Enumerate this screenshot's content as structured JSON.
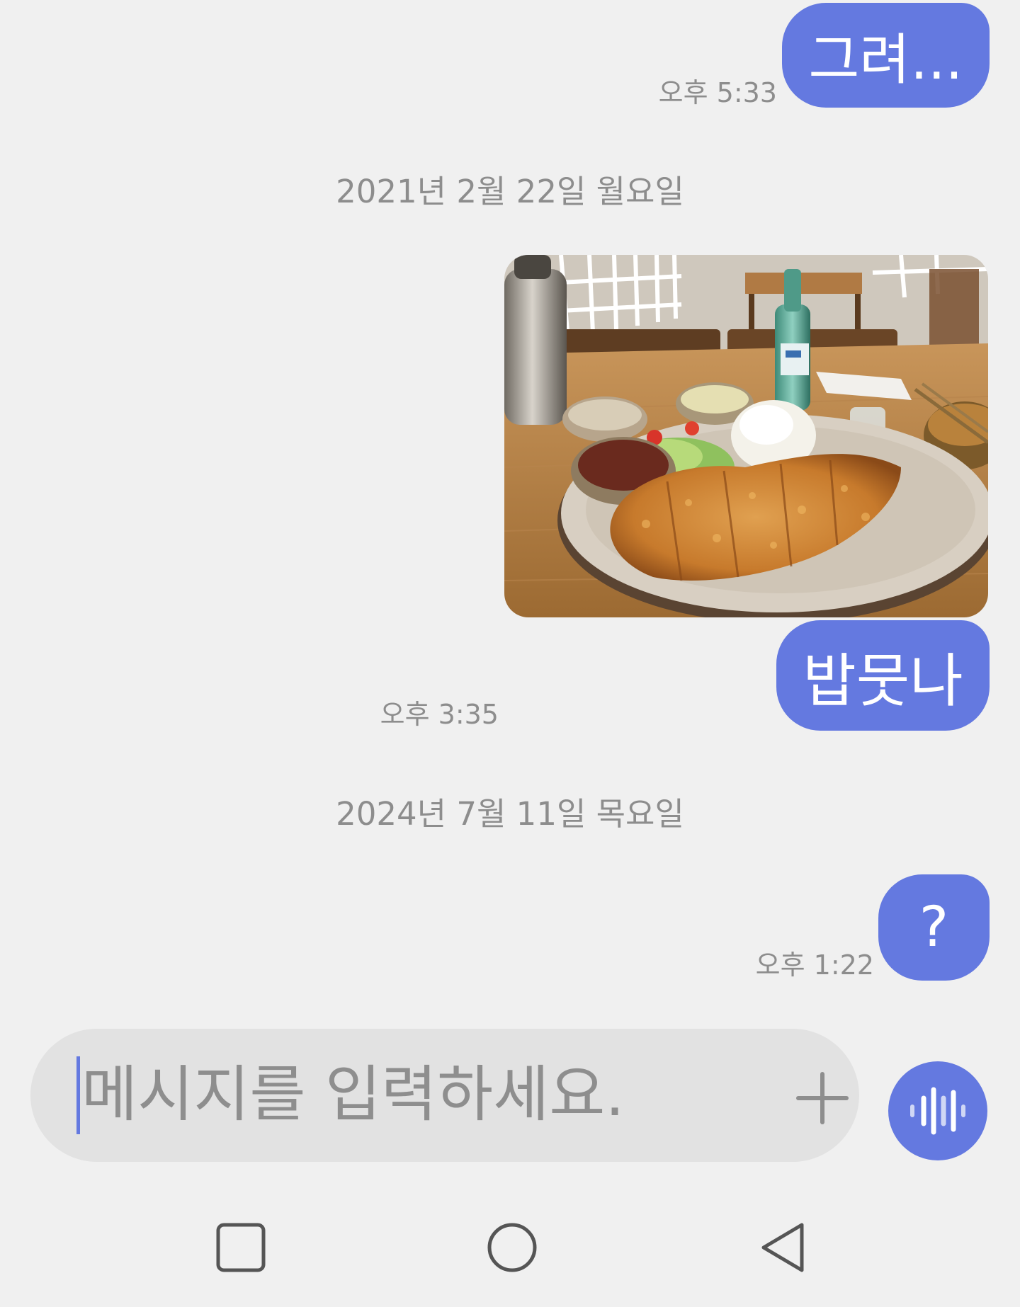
{
  "conversation": {
    "messages": [
      {
        "text": "그려...",
        "time": "오후 5:33"
      },
      {
        "text": "밥뭇나",
        "time": "오후 3:35"
      },
      {
        "text": "?",
        "time": "오후 1:22"
      }
    ],
    "date_separators": [
      "2021년 2월 22일 월요일",
      "2024년 7월 11일 목요일"
    ]
  },
  "composer": {
    "placeholder": "메시지를 입력하세요.",
    "attach_icon": "plus-icon",
    "voice_icon": "voice-waveform-icon"
  },
  "nav_bar": {
    "recents_icon": "square-icon",
    "home_icon": "circle-icon",
    "back_icon": "triangle-back-icon"
  },
  "colors": {
    "accent": "#6479e0",
    "background": "#f0f0f0",
    "secondary_text": "#8d8d8d",
    "input_background": "#e2e2e2"
  }
}
